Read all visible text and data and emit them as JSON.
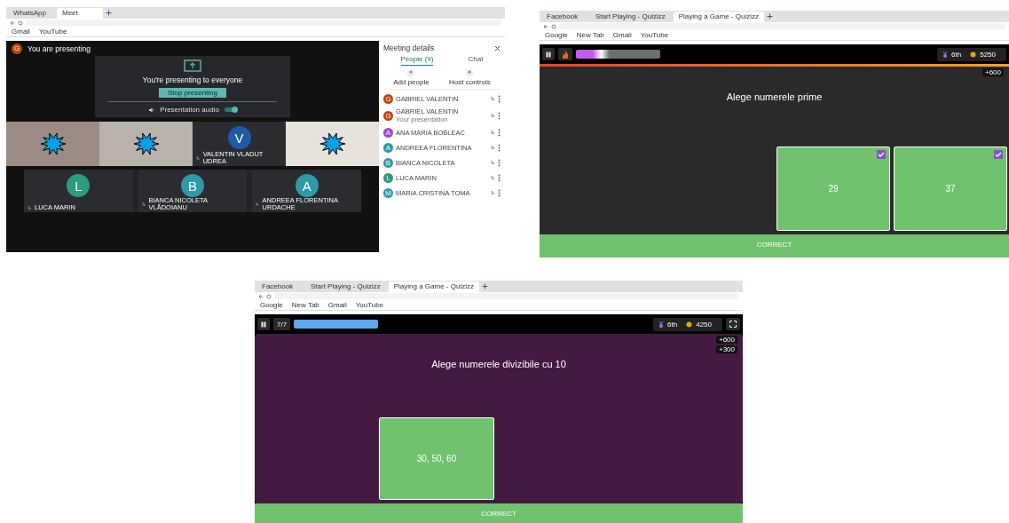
{
  "meet_window": {
    "browser": {
      "tabs": [
        {
          "label": "WhatsApp",
          "selected": false
        },
        {
          "label": "Meet",
          "selected": true
        }
      ],
      "bookmarks": [
        "Gmail",
        "YouTube"
      ]
    },
    "presenting_banner": {
      "avatar": {
        "letter": "G",
        "color": "#c1440e"
      },
      "text": "You are presenting"
    },
    "presenting_card": {
      "message": "You're presenting to everyone",
      "stop_button": "Stop presenting",
      "audio_label": "Presentation audio",
      "audio_on": true
    },
    "video_tiles": [
      {
        "kind": "video"
      },
      {
        "kind": "video"
      },
      {
        "kind": "avatar",
        "letter": "V",
        "color": "#1e5aa8",
        "name": "VALENTIN VLADUT UDREA"
      },
      {
        "kind": "video"
      }
    ],
    "avatar_tiles": [
      {
        "letter": "L",
        "color": "#2e9a7f",
        "name": "LUCA MARIN"
      },
      {
        "letter": "B",
        "color": "#2e9aa8",
        "name": "BIANCA NICOLETA VLĂDOIANU"
      },
      {
        "letter": "A",
        "color": "#2e9aa8",
        "name": "ANDREEA FLORENTINA URDACHE"
      }
    ],
    "meeting_details": {
      "title": "Meeting details",
      "tabs": [
        {
          "label": "People (9)",
          "selected": true
        },
        {
          "label": "Chat",
          "selected": false
        }
      ],
      "actions": [
        "Add people",
        "Host controls"
      ],
      "people": [
        {
          "letter": "G",
          "color": "#c1440e",
          "name": "GABRIEL VALENTIN"
        },
        {
          "letter": "G",
          "color": "#c1440e",
          "name": "GABRIEL VALENTIN",
          "note": "Your presentation"
        },
        {
          "letter": "A",
          "color": "#a04ad0",
          "name": "ANA MARIA BOBLEAC"
        },
        {
          "letter": "A",
          "color": "#2e9aa8",
          "name": "ANDREEA FLORENTINA"
        },
        {
          "letter": "B",
          "color": "#2e9aa8",
          "name": "BIANCA NICOLETA"
        },
        {
          "letter": "L",
          "color": "#2e9a7f",
          "name": "LUCA MARIN"
        },
        {
          "letter": "M",
          "color": "#2e9aa8",
          "name": "MARIA CRISTINA TOMA"
        }
      ]
    }
  },
  "quiz_window_1": {
    "kind": "dark",
    "browser": {
      "tabs": [
        {
          "label": "Facebook",
          "selected": false
        },
        {
          "label": "Start Playing - Quizizz",
          "selected": false
        },
        {
          "label": "Playing a Game - Quizizz",
          "selected": true
        }
      ],
      "bookmarks": [
        "Google",
        "New Tab",
        "Gmail",
        "YouTube"
      ]
    },
    "top_bar": {
      "kind": "powerup",
      "rank": "6th",
      "score": "5250"
    },
    "timer": {
      "level": 1
    },
    "score_chips": [
      "+600"
    ],
    "question": "Alege numerele prime",
    "options": [
      {
        "text": "29",
        "checked": true
      },
      {
        "text": "37",
        "checked": true
      }
    ],
    "result": "CORRECT"
  },
  "quiz_window_2": {
    "kind": "purple",
    "browser": {
      "tabs": [
        {
          "label": "Facebook",
          "selected": false
        },
        {
          "label": "Start Playing - Quizizz",
          "selected": false
        },
        {
          "label": "Playing a Game - Quizizz",
          "selected": true
        }
      ],
      "bookmarks": [
        "Google",
        "New Tab",
        "Gmail",
        "YouTube"
      ]
    },
    "top_bar": {
      "kind": "counter",
      "counter": "7/7",
      "rank": "6th",
      "score": "4250"
    },
    "score_chips": [
      "+600",
      "+300"
    ],
    "question": "Alege numerele divizibile cu 10",
    "options": [
      {
        "text": "30, 50, 60",
        "checked": false
      }
    ],
    "result": "CORRECT"
  }
}
